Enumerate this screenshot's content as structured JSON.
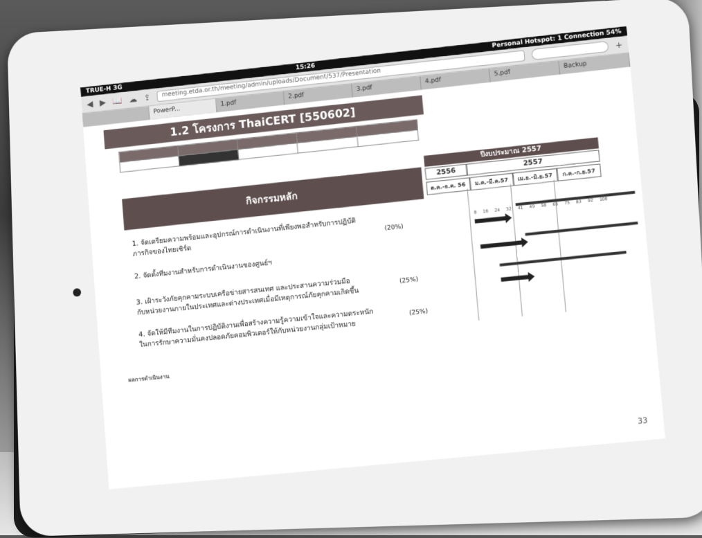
{
  "statusbar": {
    "carrier": "TRUE-H 3G",
    "time": "15:26",
    "hotspot": "Personal Hotspot: 1 Connection",
    "battery": "54%"
  },
  "toolbar": {
    "url": "meeting.etda.or.th/meeting/admin/uploads/Document/537/Presentation",
    "search_placeholder": ""
  },
  "tabs": [
    {
      "label": "",
      "active": false
    },
    {
      "label": "PowerP...",
      "active": true
    },
    {
      "label": "1.pdf",
      "active": false
    },
    {
      "label": "2.pdf",
      "active": false
    },
    {
      "label": "3.pdf",
      "active": false
    },
    {
      "label": "4.pdf",
      "active": false
    },
    {
      "label": "5.pdf",
      "active": false
    },
    {
      "label": "Backup",
      "active": false
    }
  ],
  "doc": {
    "title": "1.2 โครงการ ThaiCERT [550602]",
    "section_header": "กิจกรรมหลัก",
    "budget_header": "ปีงบประมาณ 2557",
    "year_2556": "2556",
    "year_2557": "2557",
    "quarters": [
      "ต.ค.-ธ.ค. 56",
      "ม.ค.-มี.ค.57",
      "เม.ย.-มิ.ย.57",
      "ก.ค.-ก.ย.57"
    ],
    "scale_row": [
      "8",
      "16",
      "24",
      "32",
      "41",
      "49",
      "58",
      "66",
      "75",
      "83",
      "92",
      "100"
    ],
    "activities": [
      {
        "line1": "1. จัดเตรียมความพร้อมและอุปกรณ์การดำเนินงานที่เพียงพอสำหรับการปฏิบัติ",
        "line2": "ภารกิจของไทยเซิร์ต",
        "pct": "(20%)"
      },
      {
        "line1": "2. จัดตั้งทีมงานสำหรับการดำเนินงานของศูนย์ฯ",
        "line2": "",
        "pct": ""
      },
      {
        "line1": "3. เฝ้าระวังภัยคุกคามระบบเครือข่ายสารสนเทศ และประสานความร่วมมือ",
        "line2": "กับหน่วยงานภายในประเทศและต่างประเทศเมื่อมีเหตุการณ์ภัยคุกคามเกิดขึ้น",
        "pct": "(25%)"
      },
      {
        "line1": "4. จัดให้มีทีมงานในการปฏิบัติงานเพื่อสร้างความรู้ความเข้าใจและความตระหนัก",
        "line2": "ในการรักษาความมั่นคงปลอดภัยคอมพิวเตอร์ให้กับหน่วยงานกลุ่มเป้าหมาย",
        "pct": "(25%)"
      }
    ],
    "results_heading": "ผลการดำเนินงาน",
    "page_number": "33"
  }
}
